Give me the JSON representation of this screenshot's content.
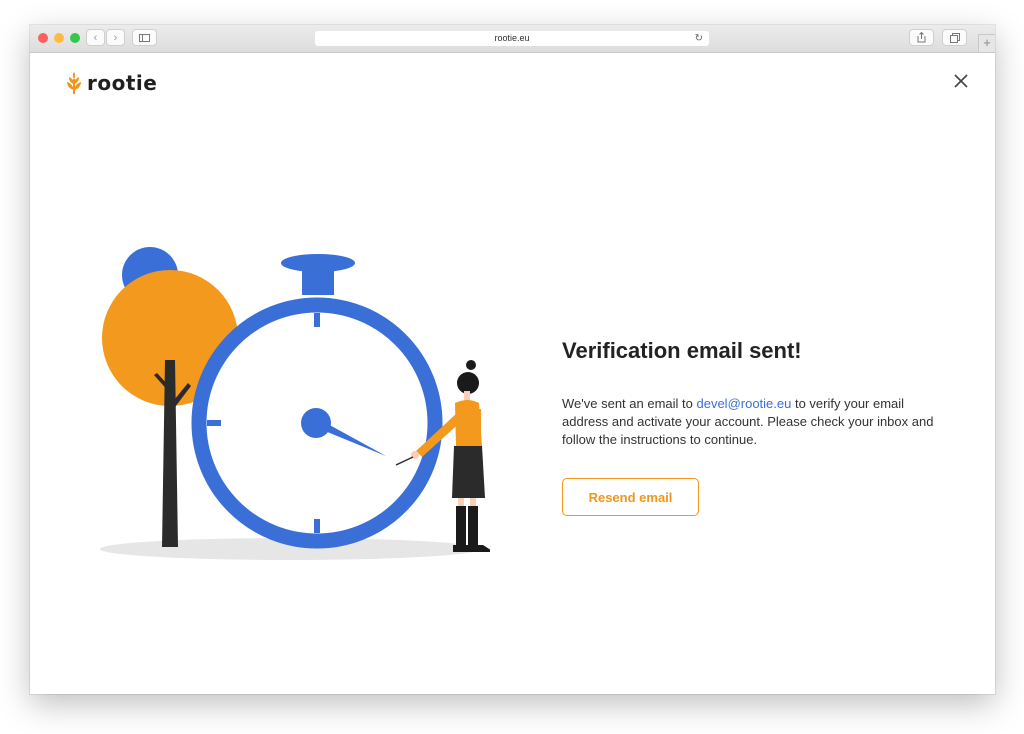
{
  "browser": {
    "url": "rootie.eu",
    "icons": {
      "back": "chevron-left-icon",
      "forward": "chevron-right-icon",
      "sidebar": "sidebar-icon",
      "reload": "reload-icon",
      "share": "share-icon",
      "tabs": "tabs-icon",
      "new_tab": "plus-icon"
    }
  },
  "header": {
    "logo_text": "rootie",
    "logo_icon": "wheat-icon",
    "close_icon": "close-icon"
  },
  "main": {
    "title": "Verification email sent!",
    "message_before": "We've sent an email to ",
    "email": "devel@rootie.eu",
    "message_after": " to verify your email address and activate your account. Please check your inbox and follow the instructions to continue.",
    "resend_label": "Resend email"
  },
  "colors": {
    "accent": "#f0961c",
    "illustration_blue": "#3a6fd8",
    "link": "#3a6fd8"
  }
}
